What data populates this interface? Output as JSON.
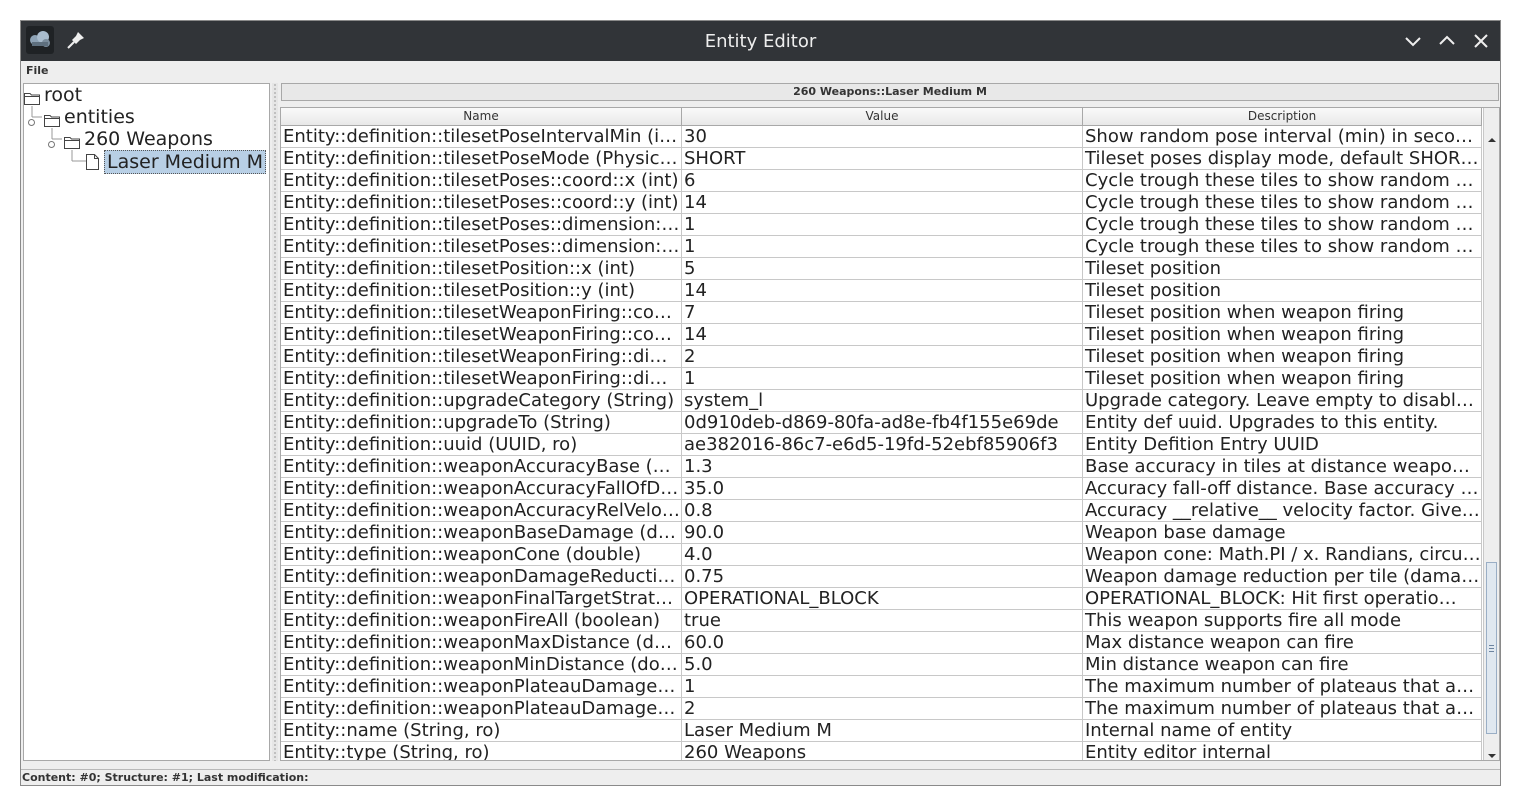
{
  "window": {
    "title": "Entity Editor"
  },
  "menu": {
    "file_label": "File"
  },
  "tree": {
    "root_label": "root",
    "entities_label": "entities",
    "weapons_label": "260 Weapons",
    "selected_label": "Laser Medium M"
  },
  "panel": {
    "header": "260 Weapons::Laser Medium M"
  },
  "table": {
    "columns": [
      "Name",
      "Value",
      "Description"
    ],
    "rows": [
      [
        "Entity::definition::tilesetPoseIntervalMin (int)",
        "30",
        "Show random pose interval (min) in seconds"
      ],
      [
        "Entity::definition::tilesetPoseMode (Physica…",
        "SHORT",
        "Tileset poses display mode, default SHOR…"
      ],
      [
        "Entity::definition::tilesetPoses::coord::x (int)",
        "6",
        "Cycle trough these tiles to show random p…"
      ],
      [
        "Entity::definition::tilesetPoses::coord::y (int)",
        "14",
        "Cycle trough these tiles to show random p…"
      ],
      [
        "Entity::definition::tilesetPoses::dimension::x…",
        "1",
        "Cycle trough these tiles to show random p…"
      ],
      [
        "Entity::definition::tilesetPoses::dimension::y…",
        "1",
        "Cycle trough these tiles to show random p…"
      ],
      [
        "Entity::definition::tilesetPosition::x (int)",
        "5",
        "Tileset position"
      ],
      [
        "Entity::definition::tilesetPosition::y (int)",
        "14",
        "Tileset position"
      ],
      [
        "Entity::definition::tilesetWeaponFiring::coor…",
        "7",
        "Tileset position when weapon firing"
      ],
      [
        "Entity::definition::tilesetWeaponFiring::coor…",
        "14",
        "Tileset position when weapon firing"
      ],
      [
        "Entity::definition::tilesetWeaponFiring::dime…",
        "2",
        "Tileset position when weapon firing"
      ],
      [
        "Entity::definition::tilesetWeaponFiring::dime…",
        "1",
        "Tileset position when weapon firing"
      ],
      [
        "Entity::definition::upgradeCategory (String)",
        "system_l",
        "Upgrade category. Leave empty to disable…"
      ],
      [
        "Entity::definition::upgradeTo (String)",
        "0d910deb-d869-80fa-ad8e-fb4f155e69de",
        "Entity def uuid. Upgrades to this entity."
      ],
      [
        "Entity::definition::uuid (UUID, ro)",
        "ae382016-86c7-e6d5-19fd-52ebf85906f3",
        "Entity Defition Entry UUID"
      ],
      [
        "Entity::definition::weaponAccuracyBase (do…",
        "1.3",
        "Base accuracy in tiles at distance weapon…"
      ],
      [
        "Entity::definition::weaponAccuracyFallOfDi…",
        "35.0",
        "Accuracy fall-off distance. Base accuracy h…"
      ],
      [
        "Entity::definition::weaponAccuracyRelVeloc…",
        "0.8",
        "Accuracy __relative__ velocity factor. Give…"
      ],
      [
        "Entity::definition::weaponBaseDamage (do…",
        "90.0",
        "Weapon base damage"
      ],
      [
        "Entity::definition::weaponCone (double)",
        "4.0",
        "Weapon cone: Math.PI / x. Randians, circul…"
      ],
      [
        "Entity::definition::weaponDamageReduction…",
        "0.75",
        "Weapon damage reduction per tile (damag…"
      ],
      [
        "Entity::definition::weaponFinalTargetStrate…",
        "OPERATIONAL_BLOCK",
        "OPERATIONAL_BLOCK: Hit first operatio…"
      ],
      [
        "Entity::definition::weaponFireAll (boolean)",
        "true",
        "This weapon supports fire all mode"
      ],
      [
        "Entity::definition::weaponMaxDistance (dou…",
        "60.0",
        "Max distance weapon can fire"
      ],
      [
        "Entity::definition::weaponMinDistance (dou…",
        "5.0",
        "Min distance weapon can fire"
      ],
      [
        "Entity::definition::weaponPlateauDamageH…",
        "1",
        "The maximum number of plateaus that are …"
      ],
      [
        "Entity::definition::weaponPlateauDamageS…",
        "2",
        "The maximum number of plateaus that are …"
      ],
      [
        "Entity::name (String, ro)",
        "Laser Medium M",
        "Internal name of entity"
      ],
      [
        "Entity::type (String, ro)",
        "260 Weapons",
        "Entity editor internal"
      ]
    ]
  },
  "status": {
    "text": "Content: #0; Structure: #1; Last modification:"
  },
  "icons": {
    "app": "app-icon",
    "pin": "pin-icon",
    "minimize": "chevron-down-icon",
    "maximize": "chevron-up-icon",
    "close": "close-icon",
    "folder": "folder-icon",
    "file": "file-icon"
  }
}
